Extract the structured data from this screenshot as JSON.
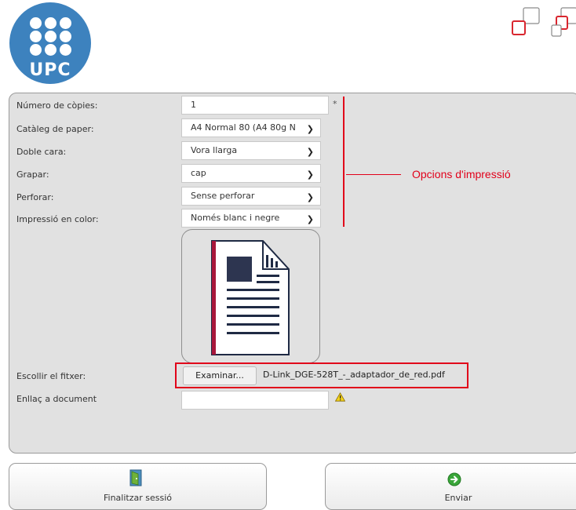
{
  "logo": {
    "text": "UPC",
    "color": "#3d82be",
    "icon": "upc-logo"
  },
  "corner_icon": "linked-squares-icon",
  "form": {
    "copies": {
      "label": "Número de còpies:",
      "value": "1",
      "required_mark": "*"
    },
    "paper": {
      "label": "Catàleg de paper:",
      "value": "A4 Normal 80 (A4 80g N"
    },
    "duplex": {
      "label": "Doble cara:",
      "value": "Vora llarga"
    },
    "staple": {
      "label": "Grapar:",
      "value": "cap"
    },
    "punch": {
      "label": "Perforar:",
      "value": "Sense perforar"
    },
    "color": {
      "label": "Impressió en color:",
      "value": "Només blanc i negre"
    },
    "file": {
      "label": "Escollir el fitxer:",
      "button": "Examinar...",
      "filename": "D-Link_DGE-528T_-_adaptador_de_red.pdf"
    },
    "link": {
      "label": "Enllaç a document",
      "value": ""
    }
  },
  "annotation": {
    "text": "Opcions d'impressió",
    "color": "#e1001a"
  },
  "buttons": {
    "logout": {
      "label": "Finalitzar sessió",
      "icon": "door-exit-icon"
    },
    "send": {
      "label": "Enviar",
      "icon": "green-arrow-icon"
    }
  }
}
